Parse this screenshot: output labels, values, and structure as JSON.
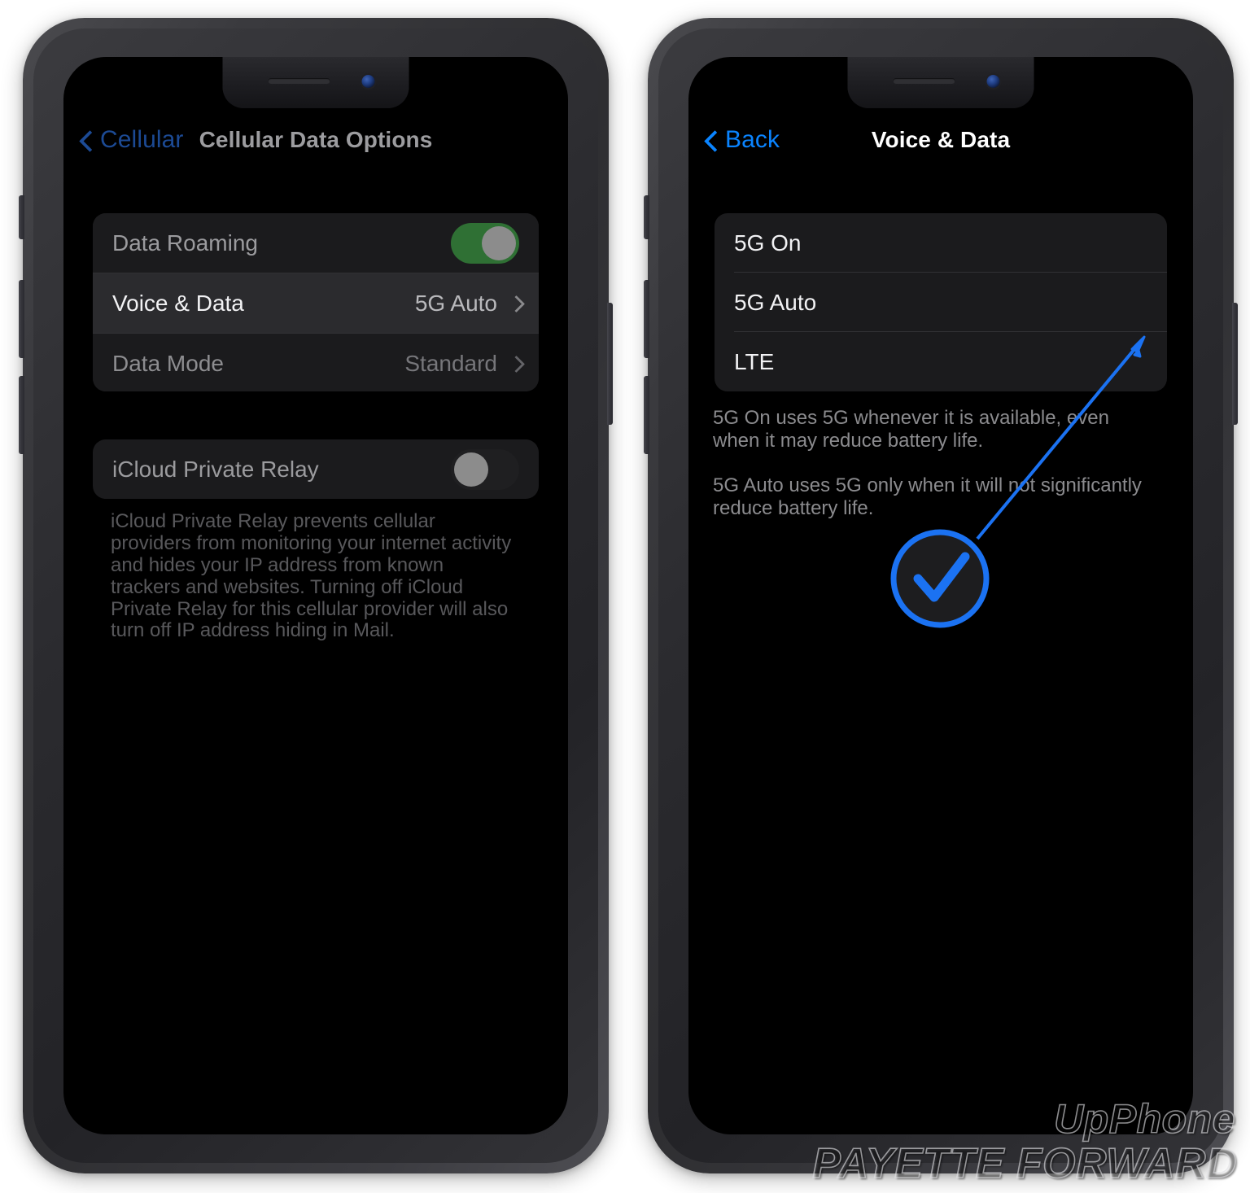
{
  "colors": {
    "ios_blue": "#0a84ff",
    "ios_blue_dim": "#1c4a94",
    "toggle_on_green": "#2f7034",
    "annotation_blue": "#1b72f2",
    "card_bg": "#1b1b1d",
    "row_highlight": "#2b2b2e",
    "screen_bg": "#000000"
  },
  "left_phone": {
    "nav": {
      "back_label": "Cellular",
      "back_icon": "chevron-left-icon",
      "title": "Cellular Data Options"
    },
    "group_1": [
      {
        "label": "Data Roaming",
        "control": "toggle",
        "toggle_state": "on",
        "highlighted": false
      },
      {
        "label": "Voice & Data",
        "control": "disclosure",
        "value": "5G Auto",
        "highlighted": true
      },
      {
        "label": "Data Mode",
        "control": "disclosure",
        "value": "Standard",
        "highlighted": false
      }
    ],
    "group_2": [
      {
        "label": "iCloud Private Relay",
        "control": "toggle",
        "toggle_state": "off"
      }
    ],
    "footnote": "iCloud Private Relay prevents cellular providers from monitoring your internet activity and hides your IP address from known trackers and websites. Turning off iCloud Private Relay for this cellular provider will also turn off IP address hiding in Mail."
  },
  "right_phone": {
    "nav": {
      "back_label": "Back",
      "back_icon": "chevron-left-icon",
      "title": "Voice & Data"
    },
    "options": [
      {
        "label": "5G On",
        "selected": false
      },
      {
        "label": "5G Auto",
        "selected": false
      },
      {
        "label": "LTE",
        "selected": false
      }
    ],
    "description": [
      "5G On uses 5G whenever it is available, even when it may reduce battery life.",
      "5G Auto uses 5G only when it will not significantly reduce battery life."
    ],
    "annotation": {
      "type": "arrow-with-checkmark-callout",
      "icon": "checkmark-icon",
      "points_to": "LTE"
    }
  },
  "watermark": {
    "line1": "UpPhone",
    "line2": "PAYETTE FORWARD"
  }
}
